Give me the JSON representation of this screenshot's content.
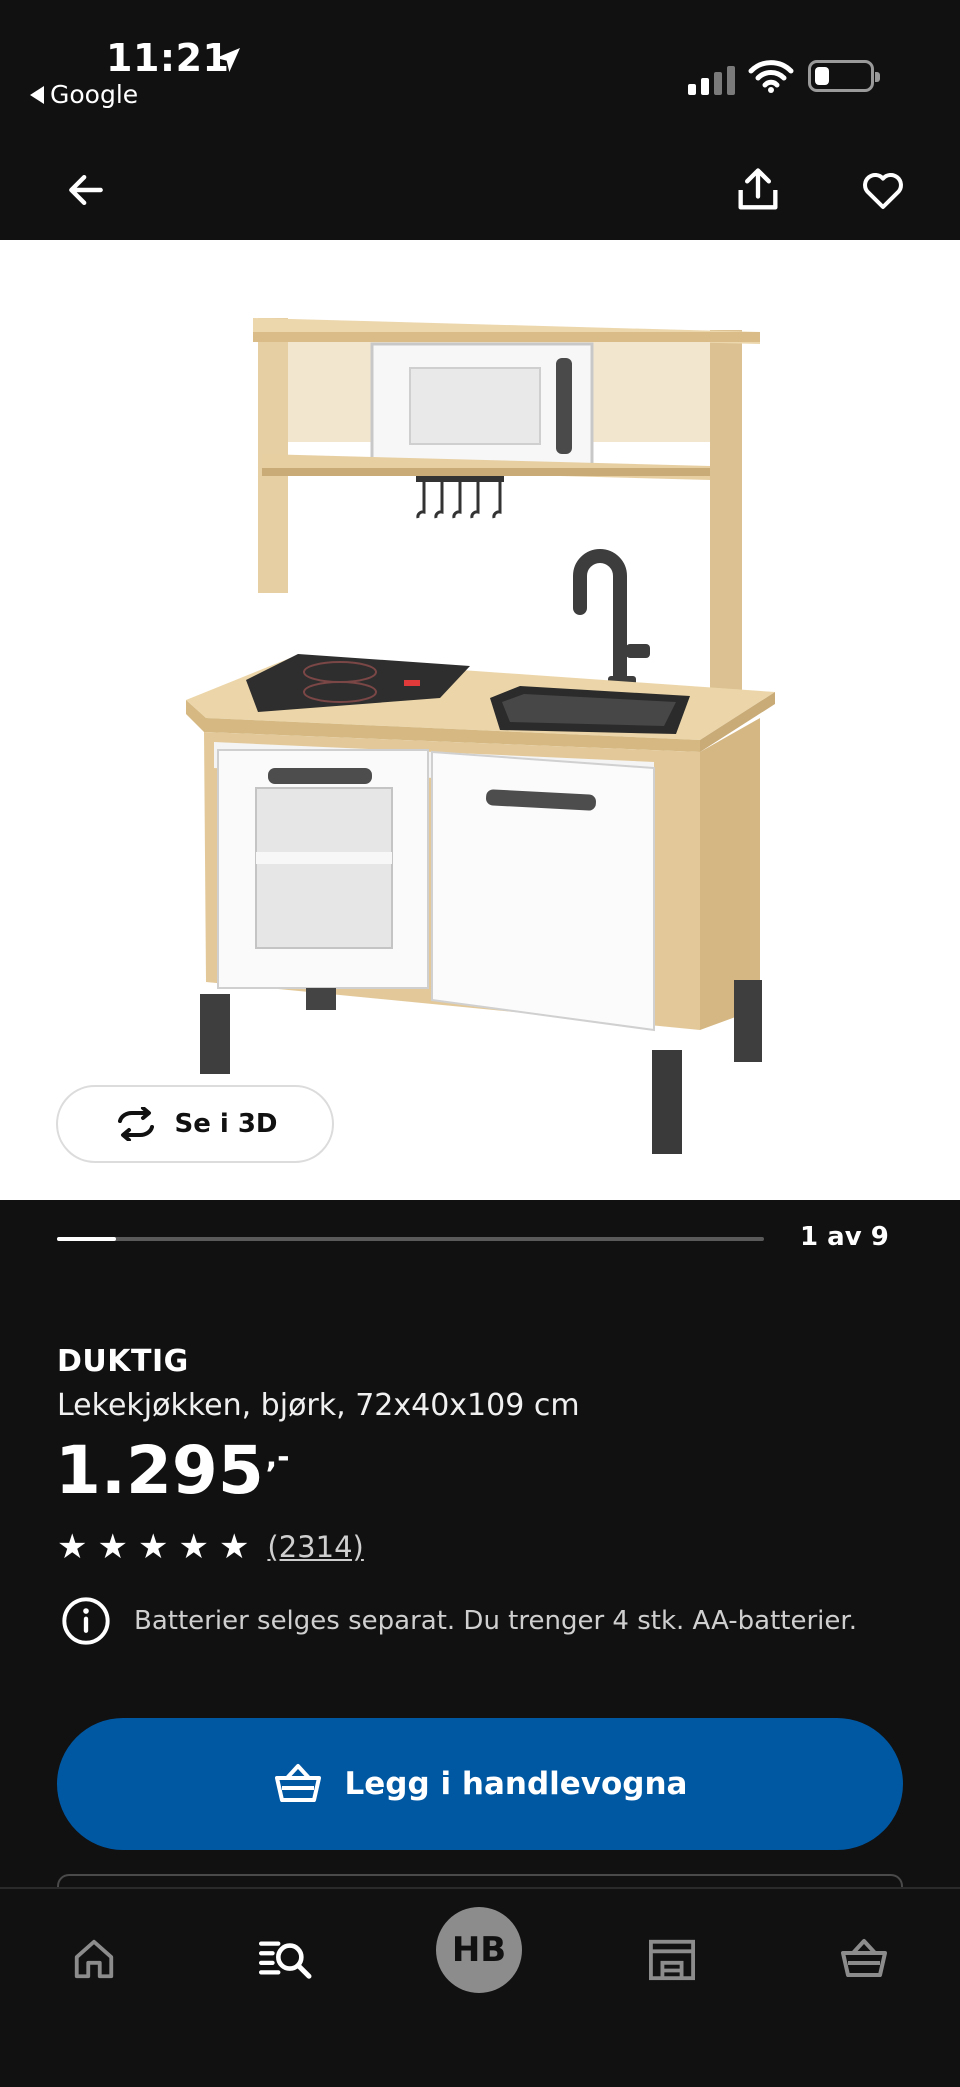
{
  "status_bar": {
    "time": "11:21",
    "back_app": "Google"
  },
  "nav": {
    "back_icon": "arrow-left-icon",
    "share_icon": "share-icon",
    "favorite_icon": "heart-icon"
  },
  "image": {
    "see_3d_label": "Se i 3D",
    "see_3d_icon": "rotate-3d-icon"
  },
  "carousel": {
    "current": 1,
    "total": 9,
    "label": "1 av 9",
    "progress": 0.083
  },
  "product": {
    "brand": "DUKTIG",
    "description": "Lekekjøkken, bjørk, 72x40x109 cm",
    "price": "1.295",
    "price_suffix": ",-",
    "rating_stars": 5,
    "review_count": "(2314)",
    "notice": "Batterier selges separat. Du trenger 4 stk. AA-batterier."
  },
  "cart_button": {
    "label": "Legg i handlevogna",
    "icon": "basket-icon",
    "color": "#0058a3"
  },
  "tab_bar": {
    "avatar_initials": "HB",
    "tabs": [
      "home-icon",
      "search-icon",
      "avatar",
      "store-icon",
      "basket-icon"
    ]
  }
}
